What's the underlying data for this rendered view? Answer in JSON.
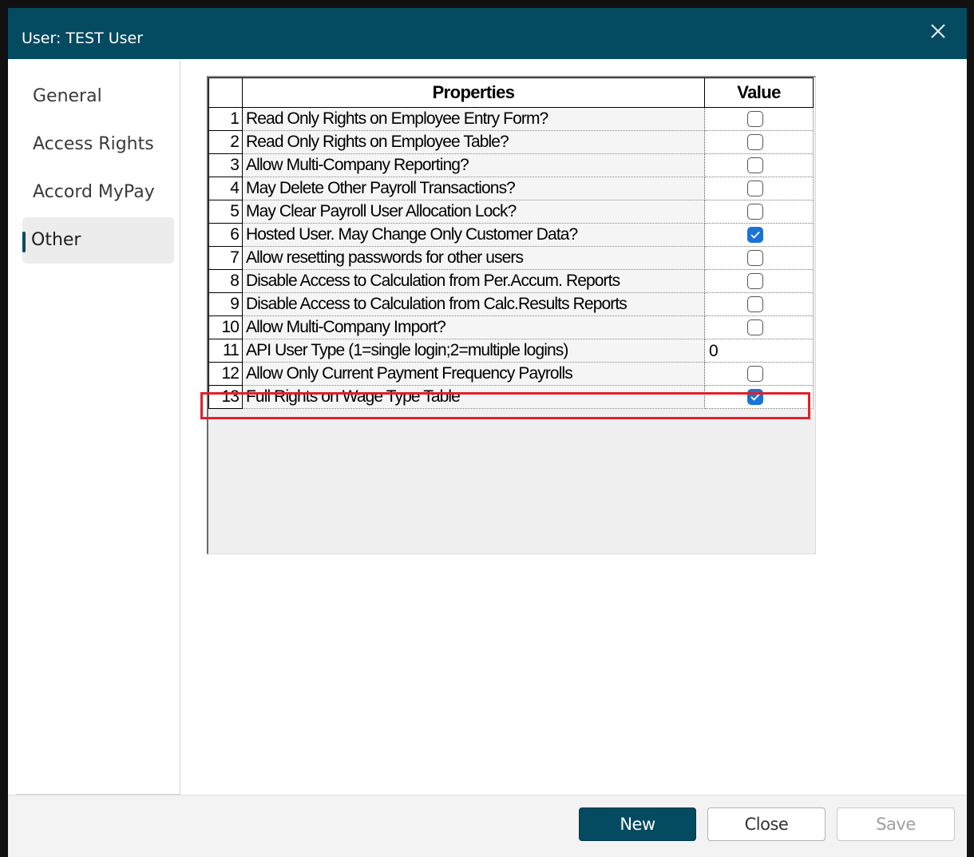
{
  "window": {
    "title": "User: TEST User"
  },
  "sidebar": {
    "items": [
      {
        "label": "General",
        "active": false
      },
      {
        "label": "Access Rights",
        "active": false
      },
      {
        "label": "Accord MyPay",
        "active": false
      },
      {
        "label": "Other",
        "active": true
      }
    ]
  },
  "grid": {
    "headers": {
      "properties": "Properties",
      "value": "Value"
    },
    "rows": [
      {
        "num": "1",
        "property": "Read Only Rights on Employee Entry Form?",
        "type": "checkbox",
        "checked": false
      },
      {
        "num": "2",
        "property": "Read Only Rights on Employee Table?",
        "type": "checkbox",
        "checked": false
      },
      {
        "num": "3",
        "property": "Allow Multi-Company Reporting?",
        "type": "checkbox",
        "checked": false
      },
      {
        "num": "4",
        "property": "May Delete Other Payroll Transactions?",
        "type": "checkbox",
        "checked": false
      },
      {
        "num": "5",
        "property": "May Clear Payroll User Allocation Lock?",
        "type": "checkbox",
        "checked": false
      },
      {
        "num": "6",
        "property": "Hosted User. May Change Only Customer Data?",
        "type": "checkbox",
        "checked": true
      },
      {
        "num": "7",
        "property": "Allow resetting passwords for other users",
        "type": "checkbox",
        "checked": false
      },
      {
        "num": "8",
        "property": "Disable Access to Calculation from Per.Accum. Reports",
        "type": "checkbox",
        "checked": false
      },
      {
        "num": "9",
        "property": "Disable Access to Calculation from Calc.Results Reports",
        "type": "checkbox",
        "checked": false
      },
      {
        "num": "10",
        "property": "Allow Multi-Company Import?",
        "type": "checkbox",
        "checked": false
      },
      {
        "num": "11",
        "property": "API User Type (1=single login;2=multiple logins)",
        "type": "text",
        "value": "0"
      },
      {
        "num": "12",
        "property": "Allow Only Current Payment Frequency Payrolls",
        "type": "checkbox",
        "checked": false
      },
      {
        "num": "13",
        "property": "Full Rights on Wage Type Table",
        "type": "checkbox",
        "checked": true,
        "highlighted": true
      }
    ]
  },
  "footer": {
    "new_label": "New",
    "close_label": "Close",
    "save_label": "Save"
  },
  "colors": {
    "titlebar": "#044a61",
    "checkbox_checked": "#1a73d6",
    "highlight": "#e0202a"
  }
}
